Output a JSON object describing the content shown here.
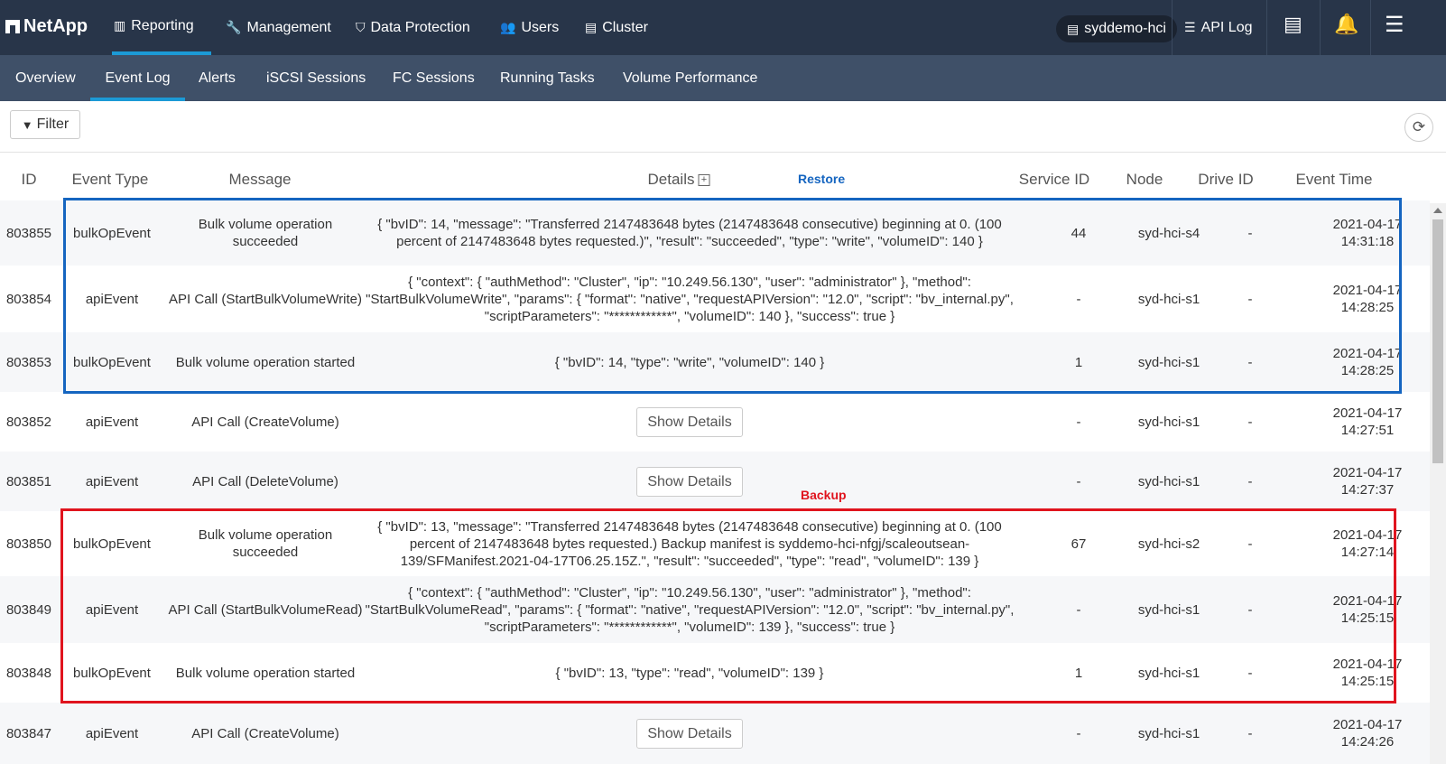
{
  "brand": "NetApp",
  "nav": {
    "reporting": "Reporting",
    "management": "Management",
    "data_protection": "Data Protection",
    "users": "Users",
    "cluster": "Cluster"
  },
  "cluster_name": "syddemo-hci",
  "api_log": "API Log",
  "subnav": [
    "Overview",
    "Event Log",
    "Alerts",
    "iSCSI Sessions",
    "FC Sessions",
    "Running Tasks",
    "Volume Performance"
  ],
  "filter_label": "Filter",
  "columns": {
    "id": "ID",
    "event_type": "Event Type",
    "message": "Message",
    "details": "Details",
    "service_id": "Service ID",
    "node": "Node",
    "drive_id": "Drive ID",
    "event_time": "Event Time"
  },
  "annotations": {
    "restore": "Restore",
    "backup": "Backup",
    "restore_color": "#1565c0",
    "backup_color": "#e0141e"
  },
  "show_details_label": "Show Details",
  "rows": [
    {
      "id": "803855",
      "type": "bulkOpEvent",
      "message": "Bulk volume operation succeeded",
      "details": "{ \"bvID\": 14, \"message\": \"Transferred 2147483648 bytes (2147483648 consecutive) beginning at 0. (100 percent of 2147483648 bytes requested.)\", \"result\": \"succeeded\", \"type\": \"write\", \"volumeID\": 140 }",
      "service": "44",
      "node": "syd-hci-s4",
      "drive": "-",
      "date": "2021-04-17",
      "time": "14:31:18"
    },
    {
      "id": "803854",
      "type": "apiEvent",
      "message": "API Call (StartBulkVolumeWrite)",
      "details": "{ \"context\": { \"authMethod\": \"Cluster\", \"ip\": \"10.249.56.130\", \"user\": \"administrator\" }, \"method\": \"StartBulkVolumeWrite\", \"params\": { \"format\": \"native\", \"requestAPIVersion\": \"12.0\", \"script\": \"bv_internal.py\", \"scriptParameters\": \"************\", \"volumeID\": 140 }, \"success\": true }",
      "service": "-",
      "node": "syd-hci-s1",
      "drive": "-",
      "date": "2021-04-17",
      "time": "14:28:25"
    },
    {
      "id": "803853",
      "type": "bulkOpEvent",
      "message": "Bulk volume operation started",
      "details": "{ \"bvID\": 14, \"type\": \"write\", \"volumeID\": 140 }",
      "service": "1",
      "node": "syd-hci-s1",
      "drive": "-",
      "date": "2021-04-17",
      "time": "14:28:25"
    },
    {
      "id": "803852",
      "type": "apiEvent",
      "message": "API Call (CreateVolume)",
      "details": "",
      "service": "-",
      "node": "syd-hci-s1",
      "drive": "-",
      "date": "2021-04-17",
      "time": "14:27:51"
    },
    {
      "id": "803851",
      "type": "apiEvent",
      "message": "API Call (DeleteVolume)",
      "details": "",
      "service": "-",
      "node": "syd-hci-s1",
      "drive": "-",
      "date": "2021-04-17",
      "time": "14:27:37"
    },
    {
      "id": "803850",
      "type": "bulkOpEvent",
      "message": "Bulk volume operation succeeded",
      "details": "{ \"bvID\": 13, \"message\": \"Transferred 2147483648 bytes (2147483648 consecutive) beginning at 0. (100 percent of 2147483648 bytes requested.) Backup manifest is syddemo-hci-nfgj/scaleoutsean-139/SFManifest.2021-04-17T06.25.15Z.\", \"result\": \"succeeded\", \"type\": \"read\", \"volumeID\": 139 }",
      "service": "67",
      "node": "syd-hci-s2",
      "drive": "-",
      "date": "2021-04-17",
      "time": "14:27:14"
    },
    {
      "id": "803849",
      "type": "apiEvent",
      "message": "API Call (StartBulkVolumeRead)",
      "details": "{ \"context\": { \"authMethod\": \"Cluster\", \"ip\": \"10.249.56.130\", \"user\": \"administrator\" }, \"method\": \"StartBulkVolumeRead\", \"params\": { \"format\": \"native\", \"requestAPIVersion\": \"12.0\", \"script\": \"bv_internal.py\", \"scriptParameters\": \"************\", \"volumeID\": 139 }, \"success\": true }",
      "service": "-",
      "node": "syd-hci-s1",
      "drive": "-",
      "date": "2021-04-17",
      "time": "14:25:15"
    },
    {
      "id": "803848",
      "type": "bulkOpEvent",
      "message": "Bulk volume operation started",
      "details": "{ \"bvID\": 13, \"type\": \"read\", \"volumeID\": 139 }",
      "service": "1",
      "node": "syd-hci-s1",
      "drive": "-",
      "date": "2021-04-17",
      "time": "14:25:15"
    },
    {
      "id": "803847",
      "type": "apiEvent",
      "message": "API Call (CreateVolume)",
      "details": "",
      "service": "-",
      "node": "syd-hci-s1",
      "drive": "-",
      "date": "2021-04-17",
      "time": "14:24:26"
    }
  ]
}
